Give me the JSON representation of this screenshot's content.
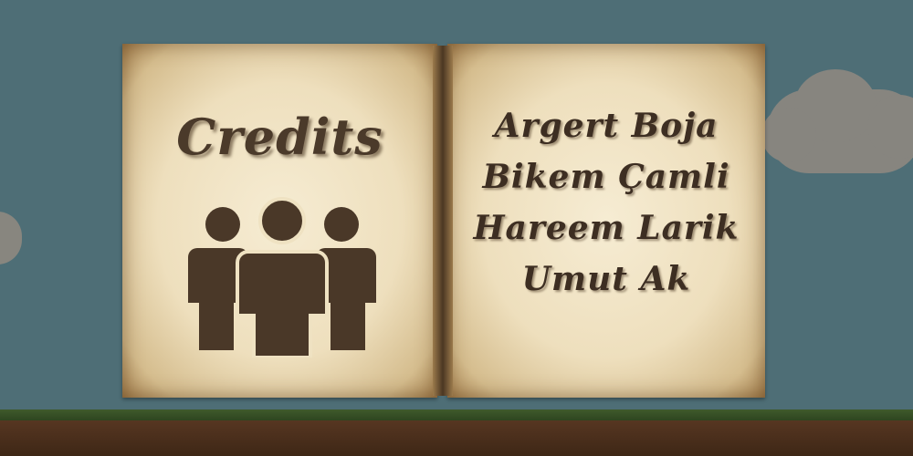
{
  "screen": {
    "title": "Credits",
    "names": [
      "Argert Boja",
      "Bikem Çamli",
      "Hareem Larik",
      "Umut Ak"
    ],
    "icon": "people-group-icon"
  },
  "colors": {
    "sky": "#4e6e76",
    "cloud": "#8b8780",
    "page": "#f1e4c4",
    "ink": "#3d2e22",
    "ground": "#5e3b25",
    "grass": "#3f5a2c"
  }
}
